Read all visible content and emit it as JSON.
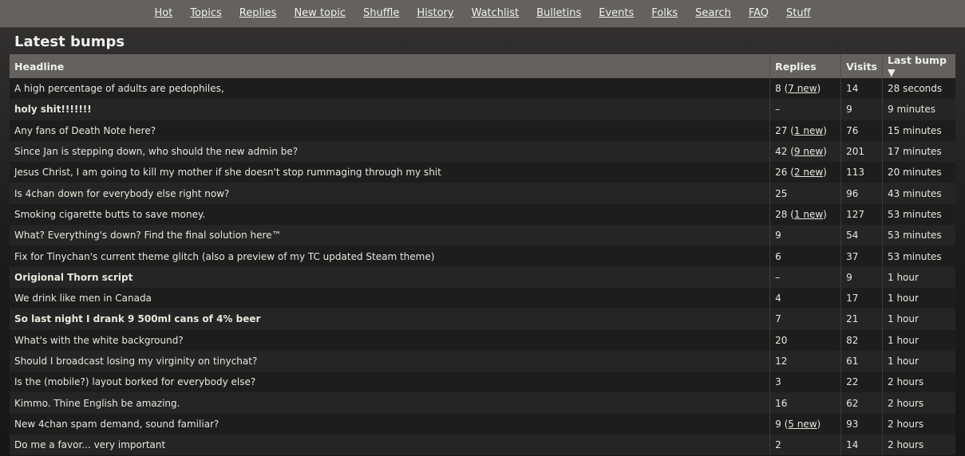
{
  "nav": [
    "Hot",
    "Topics",
    "Replies",
    "New topic",
    "Shuffle",
    "History",
    "Watchlist",
    "Bulletins",
    "Events",
    "Folks",
    "Search",
    "FAQ",
    "Stuff"
  ],
  "title": "Latest bumps",
  "columns": {
    "headline": "Headline",
    "replies": "Replies",
    "visits": "Visits",
    "last_bump": "Last bump",
    "sort_icon": "▼"
  },
  "rows": [
    {
      "headline": "A high percentage of adults are pedophiles,",
      "bold": false,
      "replies": "8",
      "new": "7 new",
      "visits": "14",
      "last": "28 seconds"
    },
    {
      "headline": "holy shit!!!!!!!",
      "bold": true,
      "replies": "–",
      "new": null,
      "visits": "9",
      "last": "9 minutes"
    },
    {
      "headline": "Any fans of Death Note here?",
      "bold": false,
      "replies": "27",
      "new": "1 new",
      "visits": "76",
      "last": "15 minutes"
    },
    {
      "headline": "Since Jan is stepping down, who should the new admin be?",
      "bold": false,
      "replies": "42",
      "new": "9 new",
      "visits": "201",
      "last": "17 minutes"
    },
    {
      "headline": "Jesus Christ, I am going to kill my mother if she doesn't stop rummaging through my shit",
      "bold": false,
      "replies": "26",
      "new": "2 new",
      "visits": "113",
      "last": "20 minutes"
    },
    {
      "headline": "Is 4chan down for everybody else right now?",
      "bold": false,
      "replies": "25",
      "new": null,
      "visits": "96",
      "last": "43 minutes"
    },
    {
      "headline": "Smoking cigarette butts to save money.",
      "bold": false,
      "replies": "28",
      "new": "1 new",
      "visits": "127",
      "last": "53 minutes"
    },
    {
      "headline": "What? Everything's down? Find the final solution here™",
      "bold": false,
      "replies": "9",
      "new": null,
      "visits": "54",
      "last": "53 minutes"
    },
    {
      "headline": "Fix for Tinychan's current theme glitch (also a preview of my TC updated Steam theme)",
      "bold": false,
      "replies": "6",
      "new": null,
      "visits": "37",
      "last": "53 minutes"
    },
    {
      "headline": "Origional Thorn script",
      "bold": true,
      "replies": "–",
      "new": null,
      "visits": "9",
      "last": "1 hour"
    },
    {
      "headline": "We drink like men in Canada",
      "bold": false,
      "replies": "4",
      "new": null,
      "visits": "17",
      "last": "1 hour"
    },
    {
      "headline": "So last night I drank 9 500ml cans of 4% beer",
      "bold": true,
      "replies": "7",
      "new": null,
      "visits": "21",
      "last": "1 hour"
    },
    {
      "headline": "What's with the white background?",
      "bold": false,
      "replies": "20",
      "new": null,
      "visits": "82",
      "last": "1 hour"
    },
    {
      "headline": "Should I broadcast losing my virginity on tinychat?",
      "bold": false,
      "replies": "12",
      "new": null,
      "visits": "61",
      "last": "1 hour"
    },
    {
      "headline": "Is the (mobile?) layout borked for everybody else?",
      "bold": false,
      "replies": "3",
      "new": null,
      "visits": "22",
      "last": "2 hours"
    },
    {
      "headline": "Kimmo. Thine English be amazing.",
      "bold": false,
      "replies": "16",
      "new": null,
      "visits": "62",
      "last": "2 hours"
    },
    {
      "headline": "New 4chan spam demand, sound familiar?",
      "bold": false,
      "replies": "9",
      "new": "5 new",
      "visits": "93",
      "last": "2 hours"
    },
    {
      "headline": "Do me a favor... very important",
      "bold": false,
      "replies": "2",
      "new": null,
      "visits": "14",
      "last": "2 hours"
    }
  ]
}
